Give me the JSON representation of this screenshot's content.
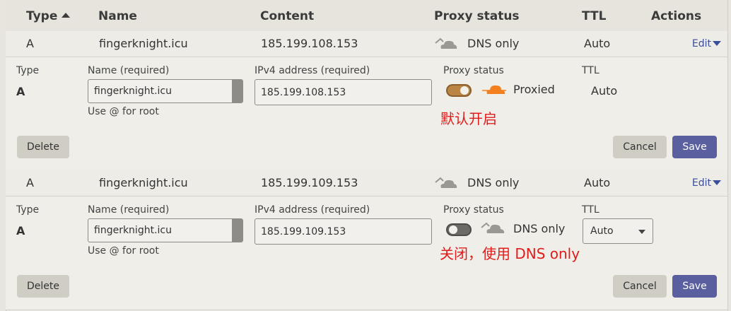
{
  "header": {
    "type": "Type",
    "name": "Name",
    "content": "Content",
    "proxy_status": "Proxy status",
    "ttl": "TTL",
    "actions": "Actions"
  },
  "records": [
    {
      "row": {
        "type": "A",
        "name": "fingerknight.icu",
        "content": "185.199.108.153",
        "proxy": "DNS only",
        "ttl": "Auto",
        "edit": "Edit"
      },
      "panel": {
        "type_label": "Type",
        "type_value": "A",
        "name_label": "Name (required)",
        "name_value": "fingerknight.icu",
        "name_hint": "Use @ for root",
        "ipv4_label": "IPv4 address (required)",
        "ipv4_value": "185.199.108.153",
        "proxy_label": "Proxy status",
        "proxy_state": "on",
        "proxy_value": "Proxied",
        "ttl_label": "TTL",
        "ttl_value": "Auto",
        "annotation": "默认开启",
        "delete": "Delete",
        "cancel": "Cancel",
        "save": "Save"
      }
    },
    {
      "row": {
        "type": "A",
        "name": "fingerknight.icu",
        "content": "185.199.109.153",
        "proxy": "DNS only",
        "ttl": "Auto",
        "edit": "Edit"
      },
      "panel": {
        "type_label": "Type",
        "type_value": "A",
        "name_label": "Name (required)",
        "name_value": "fingerknight.icu",
        "name_hint": "Use @ for root",
        "ipv4_label": "IPv4 address (required)",
        "ipv4_value": "185.199.109.153",
        "proxy_label": "Proxy status",
        "proxy_state": "off",
        "proxy_value": "DNS only",
        "ttl_label": "TTL",
        "ttl_value": "Auto",
        "annotation": "关闭，使用 DNS only",
        "delete": "Delete",
        "cancel": "Cancel",
        "save": "Save"
      }
    }
  ],
  "colors": {
    "proxied_cloud": "#f38020",
    "dns_only_cloud": "#9a9893",
    "annotation": "#e21b1b",
    "save_button": "#5a5fa0",
    "link": "#3a4e9a"
  },
  "icons": {
    "sort": "caret-up-icon",
    "dns_only": "grey-cloud-icon",
    "proxied": "orange-cloud-icon",
    "edit": "caret-down-icon",
    "select": "chevron-down-icon"
  }
}
